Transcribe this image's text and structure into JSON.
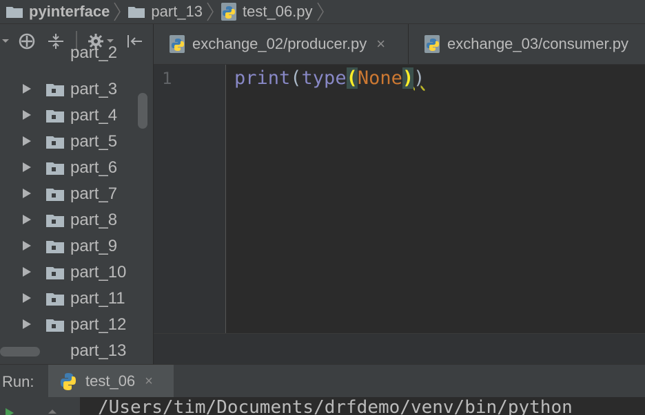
{
  "breadcrumb": [
    {
      "label": "pyinterface",
      "icon": "folder-icon"
    },
    {
      "label": "part_13",
      "icon": "folder-icon"
    },
    {
      "label": "test_06.py",
      "icon": "python-file-icon"
    }
  ],
  "project_toolbar": {
    "icons": [
      "add-target-icon",
      "collapse-all-icon",
      "gear-icon",
      "hide-panel-icon"
    ]
  },
  "tree": {
    "partial_top": "part_2",
    "items": [
      "part_3",
      "part_4",
      "part_5",
      "part_6",
      "part_7",
      "part_8",
      "part_9",
      "part_10",
      "part_11",
      "part_12"
    ],
    "partial_bottom": "part_13"
  },
  "tabs": [
    {
      "label": "exchange_02/producer.py",
      "close": "×"
    },
    {
      "label": "exchange_03/consumer.py"
    }
  ],
  "editor": {
    "line_number": "1",
    "code": {
      "fn1": "print",
      "open1": "(",
      "fn2": "type",
      "open2": "(",
      "arg": "None",
      "close2": ")",
      "close1": ")"
    }
  },
  "run": {
    "label": "Run:",
    "tab_label": "test_06",
    "close": "×",
    "console_line": "/Users/tim/Documents/drfdemo/venv/bin/python"
  },
  "colors": {
    "panel_bg": "#3c3f41",
    "editor_bg": "#2b2b2b",
    "keyword_fn": "#8888c6",
    "none_kw": "#cc7832",
    "bracket_highlight": "#ffef28"
  }
}
